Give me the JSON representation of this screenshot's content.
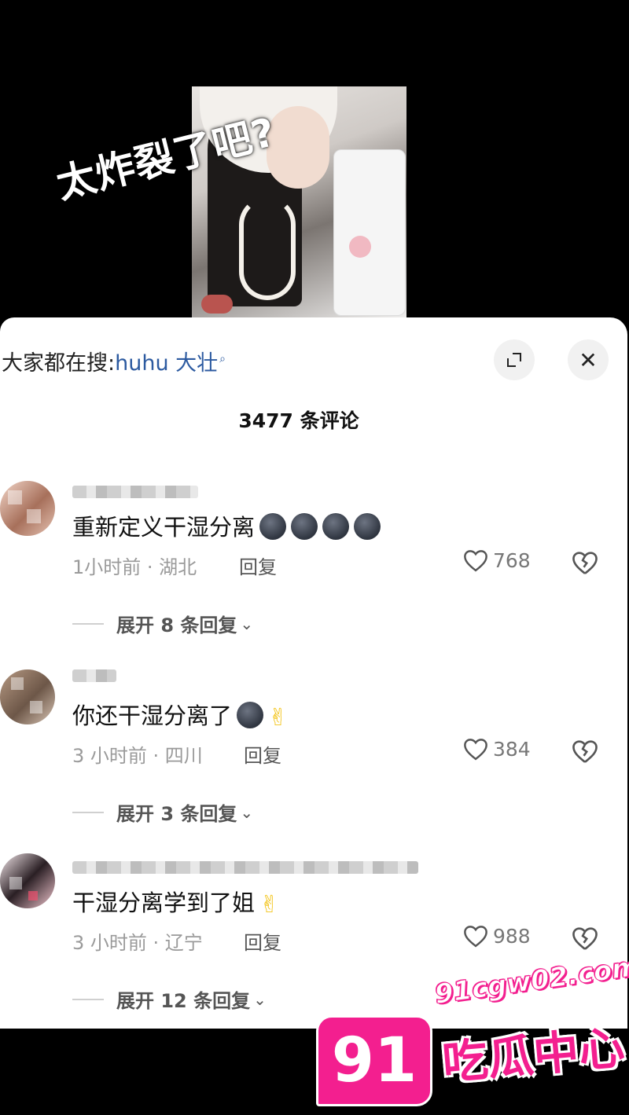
{
  "video": {
    "caption": "太炸裂了吧?"
  },
  "sheet": {
    "search_prefix": "大家都在搜:",
    "search_term": "huhu 大壮",
    "title": "3477 条评论"
  },
  "comments": [
    {
      "text": "重新定义干湿分离",
      "meta": "1小时前 · 湖北",
      "reply_label": "回复",
      "likes": "768",
      "expand_label": "展开 8 条回复"
    },
    {
      "text": "你还干湿分离了",
      "meta": "3 小时前 · 四川",
      "reply_label": "回复",
      "likes": "384",
      "expand_label": "展开 3 条回复"
    },
    {
      "text": "干湿分离学到了姐",
      "meta": "3 小时前 · 辽宁",
      "reply_label": "回复",
      "likes": "988",
      "expand_label": "展开 12 条回复"
    }
  ],
  "watermark": {
    "badge": "91",
    "url": "91cgw02.com",
    "name": "吃瓜中心"
  },
  "icons": {
    "expand": "expand-icon",
    "close": "close-icon",
    "search": "search-mini-icon",
    "like": "heart-icon",
    "dislike": "broken-heart-icon",
    "chevron": "chevron-down-icon"
  },
  "colors": {
    "search_term": "#2c5aa0",
    "watermark": "#f31f8f",
    "sheet_bg": "#ffffff"
  }
}
